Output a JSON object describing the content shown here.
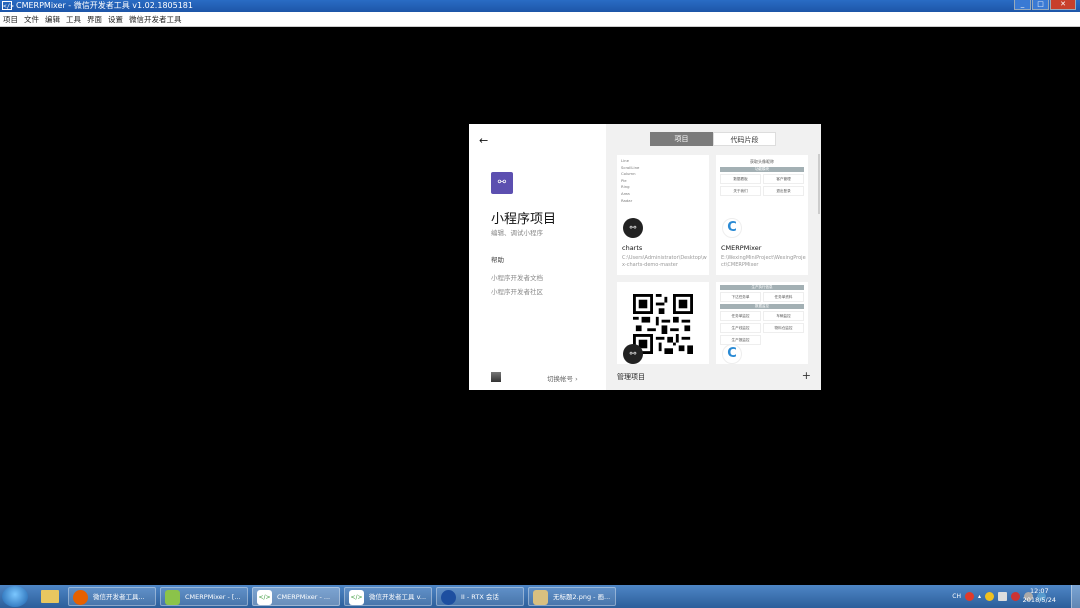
{
  "window": {
    "app_icon": "</>",
    "title": "CMERPMixer - 微信开发者工具 v1.02.1805181",
    "controls": [
      "_",
      "□",
      "✕"
    ]
  },
  "menu": [
    "项目",
    "文件",
    "编辑",
    "工具",
    "界面",
    "设置",
    "微信开发者工具"
  ],
  "left_panel": {
    "back_icon": "arrow-left-icon",
    "logo_icon": "link-icon",
    "title": "小程序项目",
    "subtitle": "编辑、调试小程序",
    "help_title": "帮助",
    "help_links": [
      "小程序开发者文档",
      "小程序开发者社区"
    ],
    "switch_account": "切换帐号"
  },
  "tabs": [
    {
      "label": "项目",
      "active": true
    },
    {
      "label": "代码片段",
      "active": false
    }
  ],
  "projects": [
    {
      "name": "charts",
      "path": "C:\\Users\\Administrator\\Desktop\\wx-charts-demo-master",
      "preview_list": [
        "Line",
        "ScrollLine",
        "Column",
        "Pie",
        "Ring",
        "Area",
        "Radar"
      ]
    },
    {
      "name": "CMERPMixer",
      "path": "E:\\WexingMiniProject\\WexingProject\\CMERPMixer",
      "preview_title": "获取头像昵称",
      "preview_bar": "功能模块",
      "preview_items": [
        "数据看板",
        "客户管理",
        "关于我们",
        "退出登录"
      ]
    },
    {
      "name": "",
      "path": ""
    },
    {
      "name": "",
      "path": "",
      "preview_bar1": "生产执行信息",
      "preview_items1": [
        "下达任务单",
        "任务单资料"
      ],
      "preview_bar2": "数据监控",
      "preview_items2": [
        "任务单监控",
        "车辆监控",
        "生产线监控",
        "物料仓监控",
        "生产报监控"
      ]
    }
  ],
  "bottom": {
    "manage": "管理项目",
    "add": "+"
  },
  "taskbar": {
    "items": [
      {
        "label": "微信开发者工具...",
        "icon": "firefox-icon",
        "color": "#e66000"
      },
      {
        "label": "CMERPMixer - [...",
        "icon": "android-icon",
        "color": "#8bc34a"
      },
      {
        "label": "CMERPMixer - ...",
        "icon": "code-icon",
        "color": "#3a9a3a"
      },
      {
        "label": "微信开发者工具 v...",
        "icon": "code-icon",
        "color": "#3a9a3a"
      },
      {
        "label": "II - RTX 会话",
        "icon": "rtx-icon",
        "color": "#1d4fa0"
      },
      {
        "label": "无标题2.png - 画...",
        "icon": "paint-icon",
        "color": "#d9c080"
      }
    ],
    "tray_lang": "CH",
    "time": "12:07",
    "date": "2018/5/24"
  }
}
